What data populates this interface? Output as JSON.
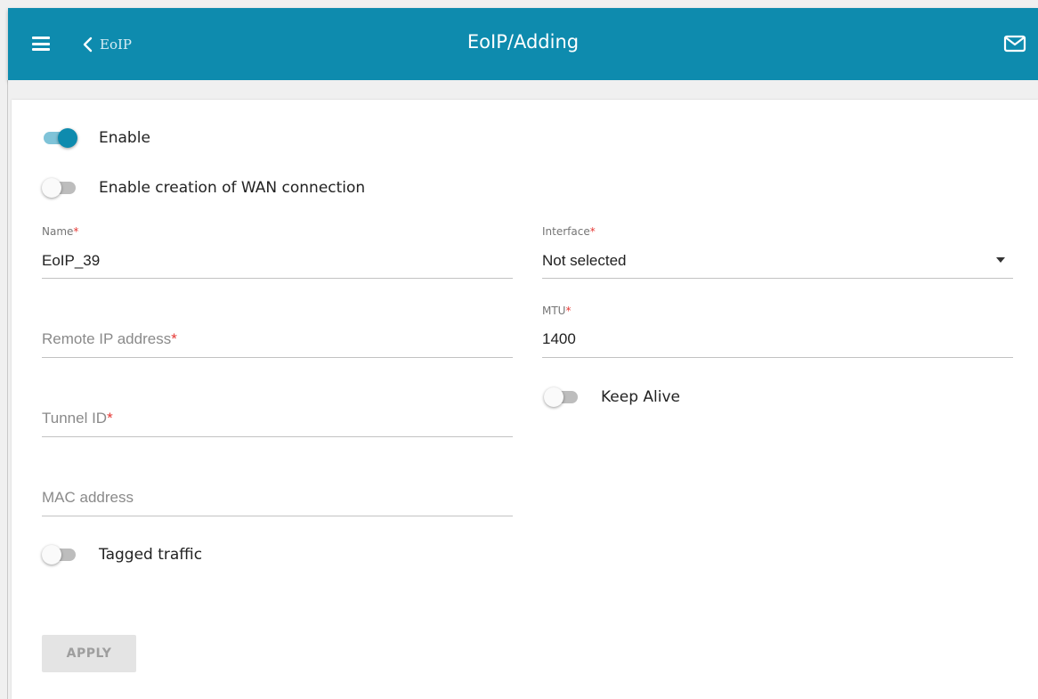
{
  "header": {
    "back_label": "EoIP",
    "title": "EoIP/Adding"
  },
  "toggles": {
    "enable": {
      "label": "Enable",
      "on": true
    },
    "wan": {
      "label": "Enable creation of WAN connection",
      "on": false
    },
    "keep_alive": {
      "label": "Keep Alive",
      "on": false
    },
    "tagged": {
      "label": "Tagged traffic",
      "on": false
    }
  },
  "fields": {
    "name": {
      "label": "Name",
      "required_mark": "*",
      "value": "EoIP_39"
    },
    "interface": {
      "label": "Interface",
      "required_mark": "*",
      "value": "Not selected"
    },
    "remote_ip": {
      "placeholder": "Remote IP address",
      "required_mark": "*"
    },
    "mtu": {
      "label": "MTU",
      "required_mark": "*",
      "value": "1400"
    },
    "tunnel_id": {
      "placeholder": "Tunnel ID",
      "required_mark": "*"
    },
    "mac": {
      "placeholder": "MAC address"
    }
  },
  "actions": {
    "apply_label": "APPLY"
  },
  "colors": {
    "header": "#0e8bae",
    "toggle_on_knob": "#0e8bae",
    "toggle_on_track": "#7fc3d8",
    "required": "#e53935"
  },
  "icons": [
    "menu-icon",
    "chevron-left-icon",
    "mail-icon",
    "chevron-down-icon"
  ]
}
